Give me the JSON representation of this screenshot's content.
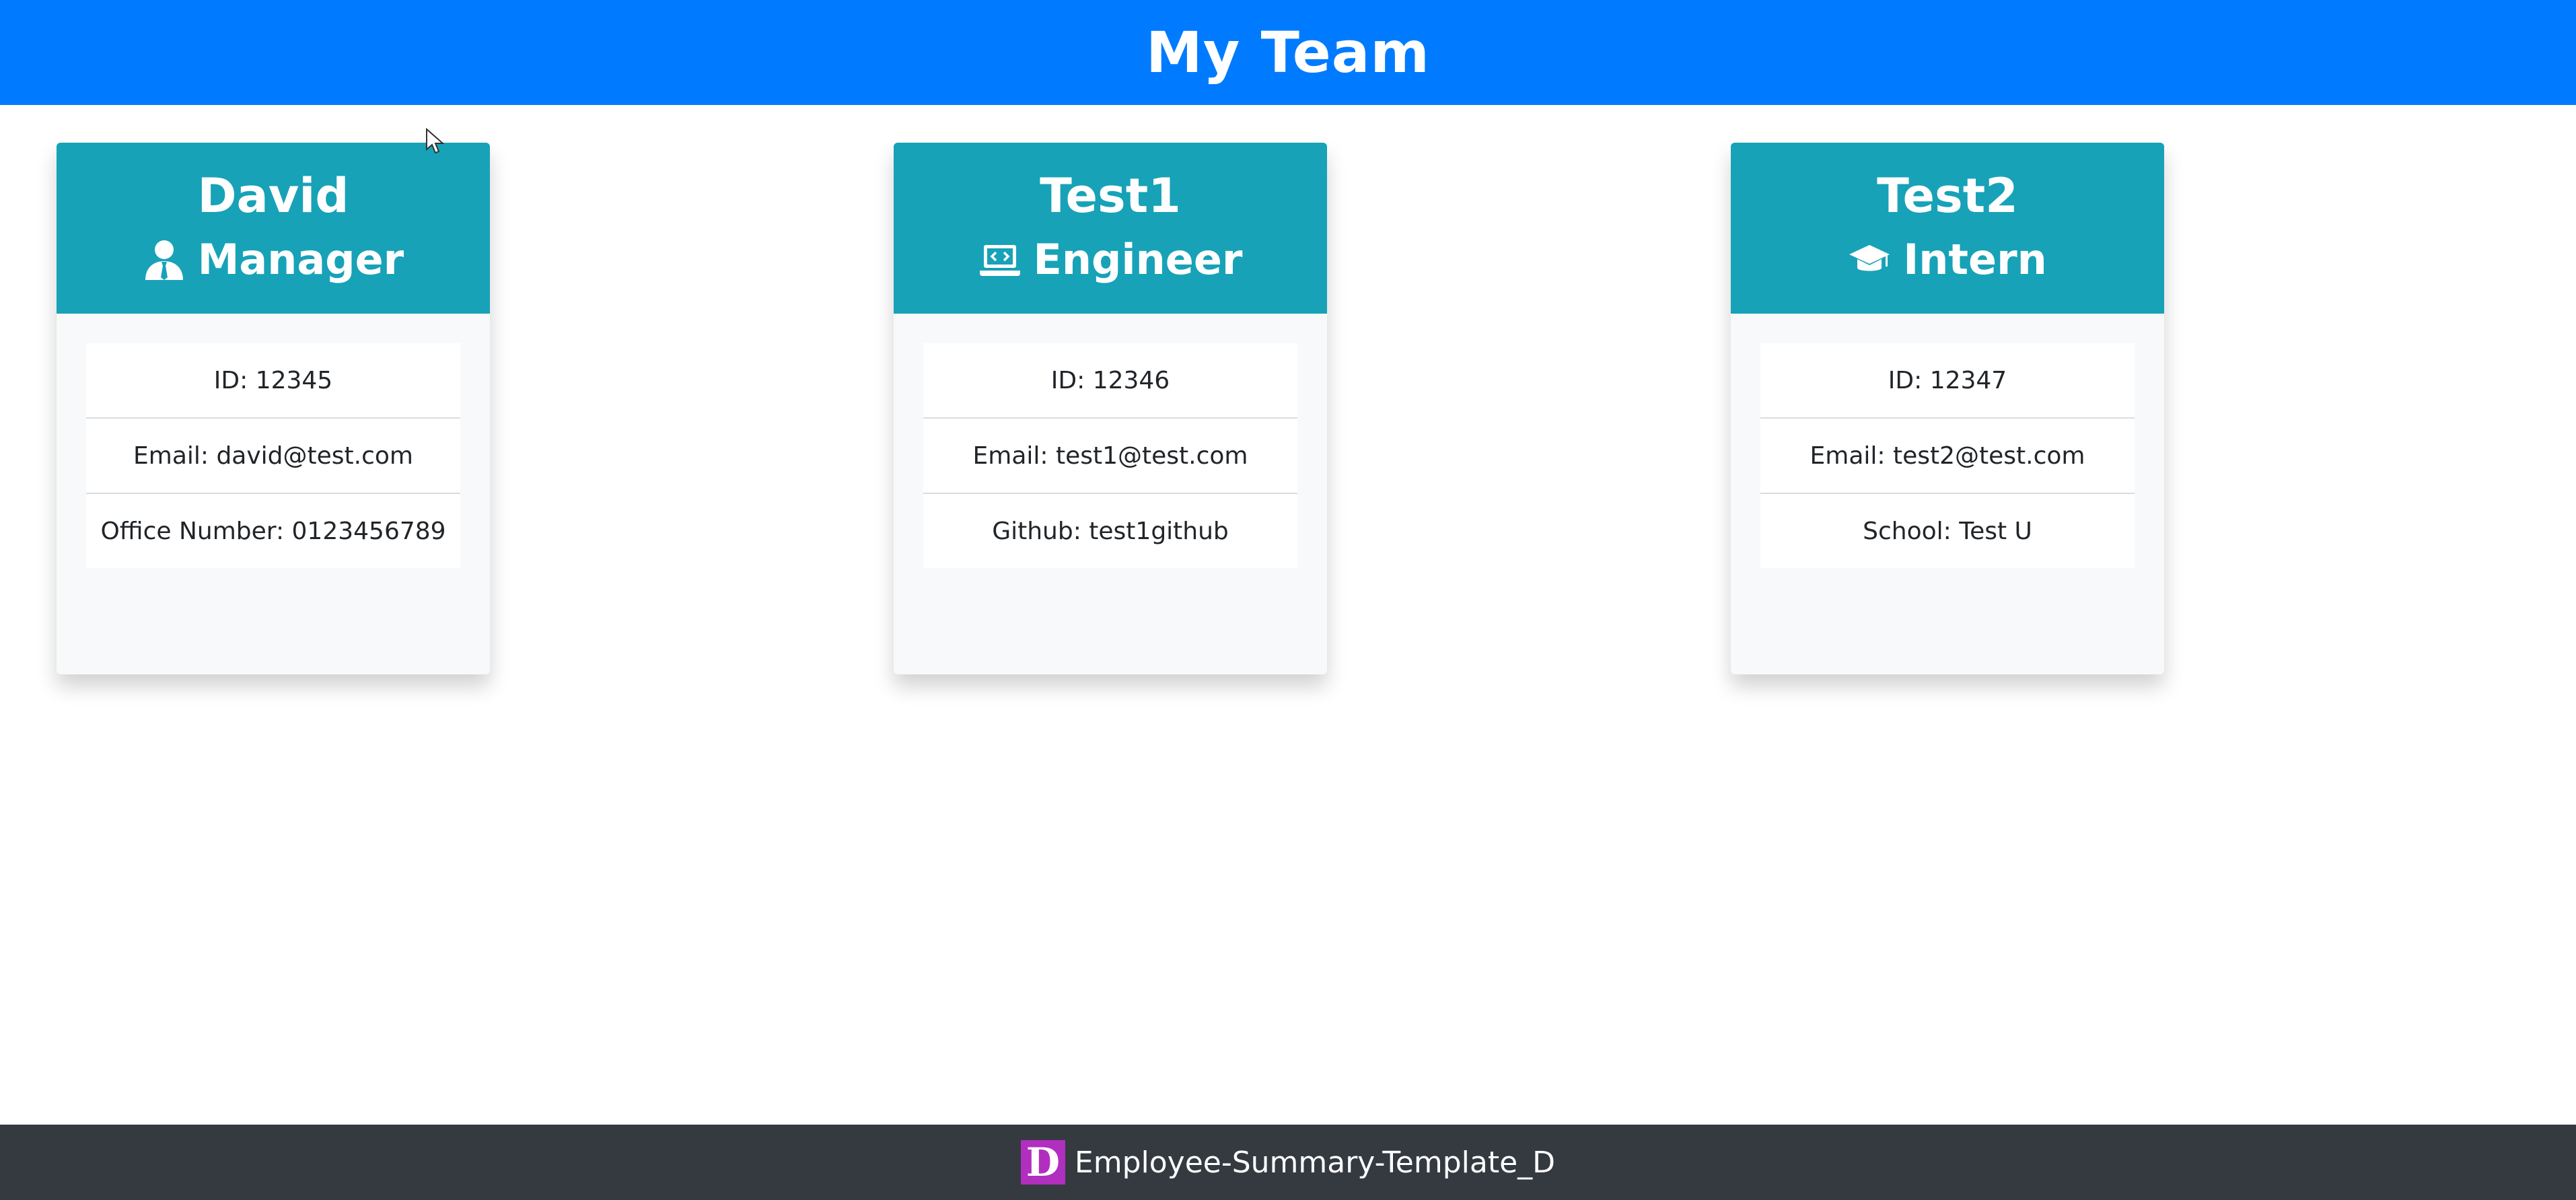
{
  "header": {
    "title": "My Team"
  },
  "cards": [
    {
      "name": "David",
      "role": "Manager",
      "icon": "user-tie-icon",
      "details": [
        "ID: 12345",
        "Email: david@test.com",
        "Office Number: 0123456789"
      ]
    },
    {
      "name": "Test1",
      "role": "Engineer",
      "icon": "laptop-code-icon",
      "details": [
        "ID: 12346",
        "Email: test1@test.com",
        "Github: test1github"
      ]
    },
    {
      "name": "Test2",
      "role": "Intern",
      "icon": "graduation-cap-icon",
      "details": [
        "ID: 12347",
        "Email: test2@test.com",
        "School: Test U"
      ]
    }
  ],
  "footer": {
    "logo_letter": "D",
    "label": "Employee-Summary-Template_D"
  },
  "colors": {
    "header": "#007bff",
    "card_header": "#17a2b8",
    "card_body": "#f8f9fa",
    "footer": "#343a40",
    "logo": "#b12fbf"
  }
}
